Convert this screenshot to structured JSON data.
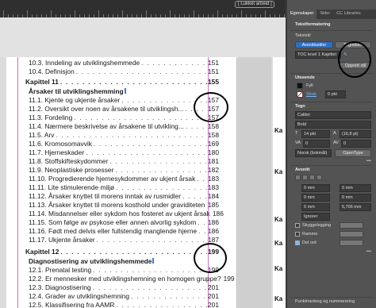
{
  "toolbar": {
    "pill_label": "[ Lukket arbeid ]",
    "icons_label": "☰ ▢ ✕"
  },
  "panel": {
    "tabs": [
      "Egenskaper",
      "Sider",
      "CC Libraries"
    ],
    "section_textformat": "Tekstformatering",
    "section_textstil": "Tekststil",
    "style_btn_1": "Avsnittsstiler",
    "style_btn_2": "Tegnstiler",
    "style_value": "TOC level 1 Kapittel",
    "create_style": "Opprett stil",
    "section_fill": "Utseende",
    "fill_label": "Fyll",
    "stroke_label": "Strek",
    "stroke_value": "0 pkt",
    "section_char": "Tegn",
    "font_value": "Calibri",
    "style_font_value": "Bold",
    "size_value": "14 pkt",
    "leading_value": "(16,8 pt)",
    "tracking_value": "0",
    "kerning_value": "0",
    "lang_value": "Norsk (bokmål)",
    "opentype_label": "OpenType",
    "section_para": "Avsnitt",
    "indent_1": "0 mm",
    "indent_2": "0 mm",
    "indent_3": "0 mm",
    "indent_4": "0 mm",
    "indent_5": "5,706 mm",
    "indent_6": "0 mm",
    "ignore_label": "Ignorer",
    "hyphen_label": "Skyggelegging",
    "frame_label": "Ramme",
    "split_label": "Del ord",
    "section_footer": "Punktmerking og nummerering"
  },
  "page2_fragments": [
    "Ka",
    "Ka",
    "Ka",
    "Ka",
    "Ka",
    "Ka"
  ],
  "toc": [
    {
      "text": "10.3. Inndeling av utviklingshemmede",
      "page": "151",
      "bold": false,
      "indent": true
    },
    {
      "text": "10.4. Definisjon",
      "page": "151",
      "bold": false,
      "indent": true
    },
    {
      "text": "Kapittel 11",
      "page": "155",
      "bold": true,
      "indent": false
    },
    {
      "text": "Årsaker til utviklingshemming",
      "page": "",
      "bold": true,
      "indent": true
    },
    {
      "text": "11.1. Kjente og ukjente årsaker",
      "page": "157",
      "bold": false,
      "indent": true
    },
    {
      "text": "11.2. Oversikt over noen av årsakene til utviklingsh...",
      "page": "157",
      "bold": false,
      "indent": true
    },
    {
      "text": "11.3. Fordeling",
      "page": "157",
      "bold": false,
      "indent": true
    },
    {
      "text": "11.4. Nærmere beskrivelse av årsakene til utvikling...",
      "page": "158",
      "bold": false,
      "indent": true
    },
    {
      "text": "11.5. Arv",
      "page": "158",
      "bold": false,
      "indent": true
    },
    {
      "text": "11.6. Kromosomavvik",
      "page": "169",
      "bold": false,
      "indent": true
    },
    {
      "text": "11.7. Hjerneskader",
      "page": "180",
      "bold": false,
      "indent": true
    },
    {
      "text": "11.8. Stoffskifteskydommer",
      "page": "181",
      "bold": false,
      "indent": true
    },
    {
      "text": "11.9. Neoplastiske prosesser",
      "page": "182",
      "bold": false,
      "indent": true
    },
    {
      "text": "11.10. Progredierende hjernesykdommer av ukjent årsak",
      "page": "183",
      "bold": false,
      "indent": true
    },
    {
      "text": "11.11. Lite stimulerende miljø",
      "page": "183",
      "bold": false,
      "indent": true
    },
    {
      "text": "11.12. Årsaker knyttet til morens inntak av rusmidler",
      "page": "184",
      "bold": false,
      "indent": true
    },
    {
      "text": "11.13. Årsaker knyttet til morens kosthold under graviditeten",
      "page": "185",
      "bold": false,
      "indent": true
    },
    {
      "text": "11.14. Misdannelser eller sykdom hos fosteret av ukjent årsak",
      "page": "186",
      "bold": false,
      "indent": true
    },
    {
      "text": "11.15. Som følge av psykose eller annen alvorlig sykdom",
      "page": "186",
      "bold": false,
      "indent": true
    },
    {
      "text": "11.16. Født med delvis eller fullstendig manglende hjerne",
      "page": "186",
      "bold": false,
      "indent": true
    },
    {
      "text": "11.17. Ukjente årsaker",
      "page": "187",
      "bold": false,
      "indent": true
    },
    {
      "text": "Kapittel 12",
      "page": "199",
      "bold": true,
      "indent": false
    },
    {
      "text": "Diagnostisering av utviklingshemmede",
      "page": "",
      "bold": true,
      "indent": true
    },
    {
      "text": "12.1. Prenatal testing",
      "page": "199",
      "bold": false,
      "indent": true
    },
    {
      "text": "12.2. Er mennesker med utviklingshemning en homogen gruppe?",
      "page": "199",
      "bold": false,
      "indent": true
    },
    {
      "text": "12.3. Diagnostisering",
      "page": "201",
      "bold": false,
      "indent": true
    },
    {
      "text": "12.4. Grader av utviklingshemning",
      "page": "201",
      "bold": false,
      "indent": true
    },
    {
      "text": "12.5. Klassifisering fra AAMR",
      "page": "201",
      "bold": false,
      "indent": true
    }
  ]
}
